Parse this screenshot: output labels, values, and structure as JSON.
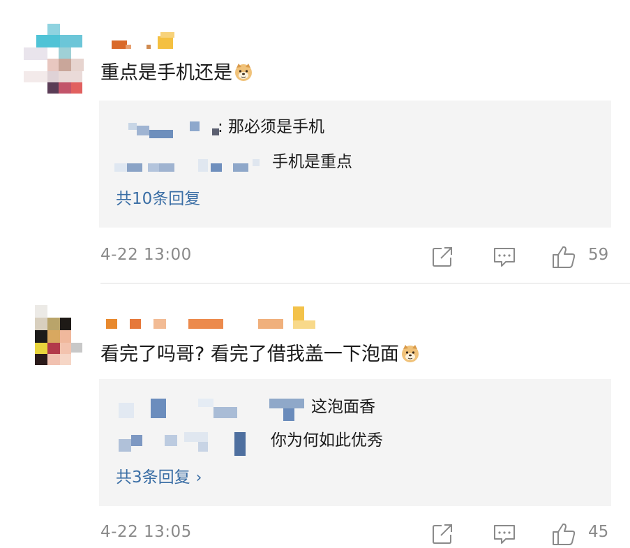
{
  "comments": [
    {
      "text": "重点是手机还是",
      "emoji": "doge-emoji",
      "replies": [
        {
          "text": ": 那必须是手机"
        },
        {
          "text": "手机是重点"
        }
      ],
      "more_replies": "共10条回复",
      "date": "4-22 13:00",
      "like_count": "59"
    },
    {
      "text": "看完了吗哥? 看完了借我盖一下泡面",
      "emoji": "doge-emoji",
      "replies": [
        {
          "text": "这泡面香"
        },
        {
          "text": "你为何如此优秀"
        }
      ],
      "more_replies": "共3条回复",
      "more_chevron": "›",
      "date": "4-22 13:05",
      "like_count": "45"
    }
  ],
  "icons": {
    "share": "share-icon",
    "comment": "comment-icon",
    "like": "thumbs-up-icon"
  },
  "colors": {
    "reply_link": "#3a6ea5",
    "meta_text": "#8a8a8a",
    "reply_bg": "#f4f4f4"
  }
}
